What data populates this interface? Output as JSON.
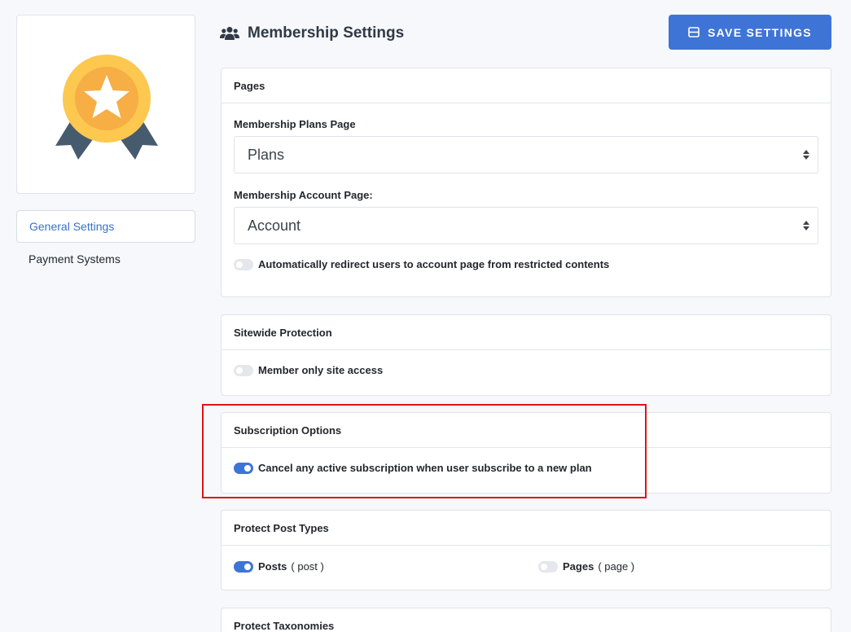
{
  "sidebar": {
    "items": [
      {
        "label": "General Settings",
        "active": true
      },
      {
        "label": "Payment Systems",
        "active": false
      }
    ]
  },
  "header": {
    "title": "Membership Settings",
    "title_icon": "users-icon",
    "save_label": "SAVE SETTINGS",
    "save_icon": "save-icon"
  },
  "colors": {
    "accent": "#3f74d7",
    "highlight": "#e0131a",
    "medal_gold": "#fcc84f",
    "medal_ribbon": "#475b6f"
  },
  "pages_panel": {
    "title": "Pages",
    "plans_label": "Membership Plans Page",
    "plans_value": "Plans",
    "account_label": "Membership Account Page:",
    "account_value": "Account",
    "redirect_label": "Automatically redirect users to account page from restricted contents",
    "redirect_on": false
  },
  "sitewide_panel": {
    "title": "Sitewide Protection",
    "member_only_label": "Member only site access",
    "member_only_on": false
  },
  "subscription_panel": {
    "title": "Subscription Options",
    "cancel_label": "Cancel any active subscription when user subscribe to a new plan",
    "cancel_on": true
  },
  "post_types_panel": {
    "title": "Protect Post Types",
    "items": [
      {
        "label": "Posts",
        "slug": "( post )",
        "on": true
      },
      {
        "label": "Pages",
        "slug": "( page )",
        "on": false
      }
    ]
  },
  "taxonomies_panel": {
    "title": "Protect Taxonomies"
  }
}
